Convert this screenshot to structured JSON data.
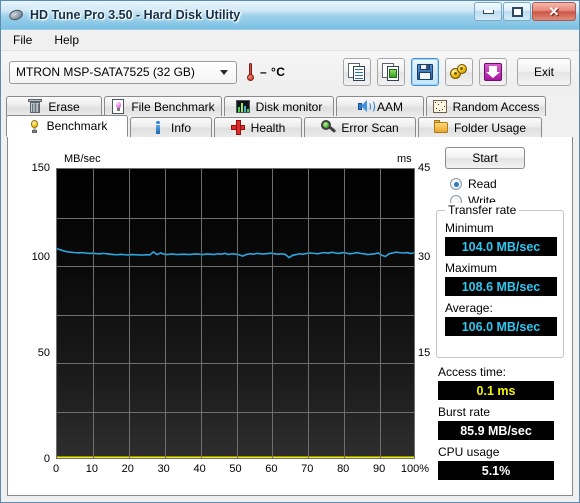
{
  "window": {
    "title": "HD Tune Pro 3.50 - Hard Disk Utility",
    "icon": "hard-disk-icon",
    "minimize": "–",
    "maximize": "□",
    "close": "✕"
  },
  "menu": {
    "items": [
      {
        "label": "File"
      },
      {
        "label": "Help"
      }
    ]
  },
  "toolbar": {
    "drive": "MTRON MSP-SATA7525 (32 GB)",
    "temperature": "– °C",
    "thermometer_icon": "thermometer-icon",
    "buttons": [
      {
        "name": "copy-text-icon",
        "title": "Copy text"
      },
      {
        "name": "copy-image-icon",
        "title": "Copy image"
      },
      {
        "name": "save-icon",
        "title": "Save",
        "selected": true
      },
      {
        "name": "options-gears-icon",
        "title": "Options"
      },
      {
        "name": "download-arrow-icon",
        "title": "Download"
      }
    ],
    "exit_label": "Exit"
  },
  "tabs": {
    "row1": [
      {
        "label": "Erase",
        "icon": "trash-icon",
        "active": false
      },
      {
        "label": "File Benchmark",
        "icon": "file-benchmark-icon",
        "active": false
      },
      {
        "label": "Disk monitor",
        "icon": "disk-monitor-icon",
        "active": false
      },
      {
        "label": "AAM",
        "icon": "speaker-icon",
        "active": false
      },
      {
        "label": "Random Access",
        "icon": "random-access-icon",
        "active": false
      }
    ],
    "row2": [
      {
        "label": "Benchmark",
        "icon": "lightbulb-icon",
        "active": true
      },
      {
        "label": "Info",
        "icon": "info-icon",
        "active": false
      },
      {
        "label": "Health",
        "icon": "health-cross-icon",
        "active": false
      },
      {
        "label": "Error Scan",
        "icon": "magnifier-icon",
        "active": false
      },
      {
        "label": "Folder Usage",
        "icon": "folder-icon",
        "active": false
      }
    ]
  },
  "side": {
    "start_label": "Start",
    "mode_read": "Read",
    "mode_write": "Write",
    "mode_selected": "Read",
    "transfer_group_label": "Transfer rate",
    "minimum_label": "Minimum",
    "minimum_value": "104.0 MB/sec",
    "maximum_label": "Maximum",
    "maximum_value": "108.6 MB/sec",
    "average_label": "Average:",
    "average_value": "106.0 MB/sec",
    "access_time_label": "Access time:",
    "access_time_value": "0.1 ms",
    "burst_rate_label": "Burst rate",
    "burst_rate_value": "85.9 MB/sec",
    "cpu_usage_label": "CPU usage",
    "cpu_usage_value": "5.1%"
  },
  "colors": {
    "transfer_line": "#29a8e0",
    "access_line": "#f2f20a",
    "lcd_cyan": "#2fc6f0",
    "lcd_yellow": "#f2f20a",
    "plot_bg": "#000000",
    "grid": "#6e6e6e"
  },
  "chart_data": {
    "type": "line",
    "title": "",
    "xlabel": "",
    "ylabel": "MB/sec",
    "y2label": "ms",
    "xlim": [
      0,
      100
    ],
    "ylim": [
      0,
      150
    ],
    "y2lim": [
      0,
      45
    ],
    "grid": true,
    "x_ticks": [
      "0",
      "10",
      "20",
      "30",
      "40",
      "50",
      "60",
      "70",
      "80",
      "90",
      "100%"
    ],
    "y_ticks": [
      "0",
      "50",
      "100",
      "150"
    ],
    "y2_ticks": [
      "15",
      "30",
      "45"
    ],
    "legend_position": "none",
    "series": [
      {
        "name": "Transfer rate",
        "axis": "left",
        "units": "MB/sec",
        "color": "#29a8e0",
        "x": [
          0,
          1,
          2,
          3,
          4,
          5,
          6,
          7,
          8,
          9,
          10,
          11,
          12,
          13,
          14,
          15,
          16,
          17,
          18,
          19,
          20,
          21,
          22,
          23,
          24,
          25,
          26,
          27,
          28,
          29,
          30,
          31,
          32,
          33,
          34,
          35,
          36,
          37,
          38,
          39,
          40,
          41,
          42,
          43,
          44,
          45,
          46,
          47,
          48,
          49,
          50,
          51,
          52,
          53,
          54,
          55,
          56,
          57,
          58,
          59,
          60,
          61,
          62,
          63,
          64,
          65,
          66,
          67,
          68,
          69,
          70,
          71,
          72,
          73,
          74,
          75,
          76,
          77,
          78,
          79,
          80,
          81,
          82,
          83,
          84,
          85,
          86,
          87,
          88,
          89,
          90,
          91,
          92,
          93,
          94,
          95,
          96,
          97,
          98,
          99,
          100
        ],
        "values": [
          108.6,
          108.0,
          107.4,
          107.0,
          106.8,
          106.6,
          106.5,
          106.6,
          106.4,
          106.2,
          106.3,
          106.1,
          106.0,
          106.2,
          106.0,
          105.8,
          105.6,
          105.5,
          105.7,
          105.5,
          105.4,
          105.6,
          105.5,
          105.4,
          105.3,
          105.5,
          105.4,
          107.0,
          105.6,
          106.4,
          105.8,
          105.6,
          105.9,
          105.7,
          105.6,
          105.8,
          105.7,
          105.6,
          105.8,
          105.9,
          105.7,
          105.6,
          105.9,
          105.8,
          105.6,
          106.0,
          105.8,
          106.2,
          105.6,
          106.0,
          105.8,
          105.5,
          104.8,
          105.6,
          106.0,
          105.8,
          106.2,
          106.0,
          105.9,
          106.1,
          106.3,
          106.0,
          105.8,
          106.0,
          105.6,
          104.0,
          105.2,
          105.6,
          106.0,
          105.8,
          106.2,
          106.4,
          106.2,
          106.0,
          106.4,
          106.6,
          106.3,
          106.8,
          106.4,
          106.2,
          106.6,
          106.4,
          106.0,
          106.2,
          106.6,
          106.2,
          106.0,
          105.6,
          105.8,
          106.0,
          106.4,
          105.2,
          104.6,
          106.0,
          106.4,
          106.8,
          106.6,
          106.4,
          106.6,
          106.2,
          106.4
        ],
        "min": 104.0,
        "max": 108.6,
        "avg": 106.0
      },
      {
        "name": "Access time",
        "axis": "right",
        "units": "ms",
        "color": "#f2f20a",
        "x": [
          0,
          2,
          4,
          6,
          8,
          10,
          12,
          14,
          16,
          18,
          20,
          22,
          24,
          26,
          28,
          30,
          32,
          34,
          36,
          38,
          40,
          42,
          44,
          46,
          48,
          50,
          52,
          54,
          56,
          58,
          60,
          62,
          64,
          66,
          68,
          70,
          72,
          74,
          76,
          78,
          80,
          82,
          84,
          86,
          88,
          90,
          92,
          94,
          96,
          98,
          100
        ],
        "values": [
          0.1,
          0.1,
          0.1,
          0.1,
          0.1,
          0.1,
          0.1,
          0.1,
          0.1,
          0.1,
          0.1,
          0.1,
          0.1,
          0.1,
          0.1,
          0.1,
          0.1,
          0.1,
          0.1,
          0.1,
          0.1,
          0.1,
          0.1,
          0.1,
          0.1,
          0.1,
          0.1,
          0.1,
          0.1,
          0.1,
          0.1,
          0.1,
          0.1,
          0.1,
          0.1,
          0.1,
          0.1,
          0.1,
          0.1,
          0.1,
          0.1,
          0.1,
          0.1,
          0.1,
          0.1,
          0.1,
          0.1,
          0.1,
          0.1,
          0.1,
          0.1
        ],
        "avg": 0.1
      }
    ]
  }
}
